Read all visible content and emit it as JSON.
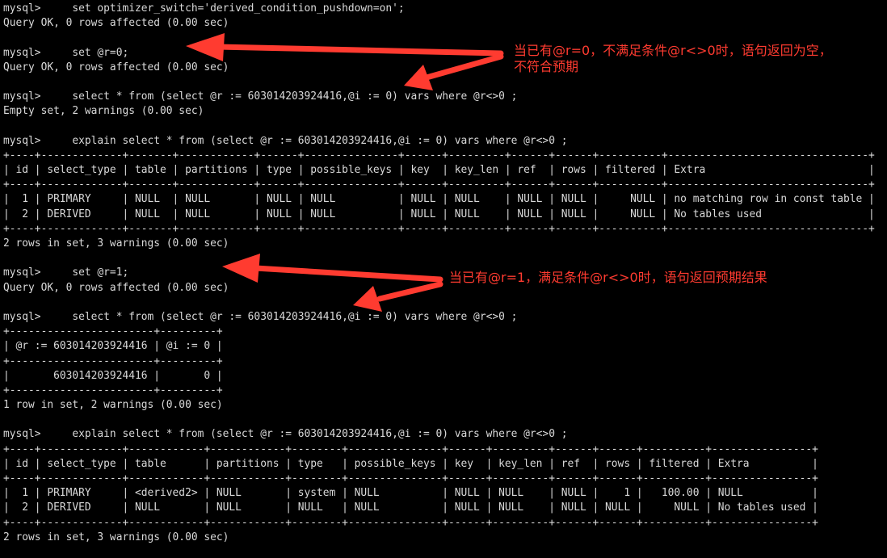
{
  "terminal": {
    "lines": [
      "mysql>     set optimizer_switch='derived_condition_pushdown=on';",
      "Query OK, 0 rows affected (0.00 sec)",
      "",
      "mysql>     set @r=0;",
      "Query OK, 0 rows affected (0.00 sec)",
      "",
      "mysql>     select * from (select @r := 603014203924416,@i := 0) vars where @r<>0 ;",
      "Empty set, 2 warnings (0.00 sec)",
      "",
      "mysql>     explain select * from (select @r := 603014203924416,@i := 0) vars where @r<>0 ;",
      "+----+-------------+-------+------------+------+---------------+------+---------+------+------+----------+--------------------------------+",
      "| id | select_type | table | partitions | type | possible_keys | key  | key_len | ref  | rows | filtered | Extra                          |",
      "+----+-------------+-------+------------+------+---------------+------+---------+------+------+----------+--------------------------------+",
      "|  1 | PRIMARY     | NULL  | NULL       | NULL | NULL          | NULL | NULL    | NULL | NULL |     NULL | no matching row in const table |",
      "|  2 | DERIVED     | NULL  | NULL       | NULL | NULL          | NULL | NULL    | NULL | NULL |     NULL | No tables used                 |",
      "+----+-------------+-------+------------+------+---------------+------+---------+------+------+----------+--------------------------------+",
      "2 rows in set, 3 warnings (0.00 sec)",
      "",
      "mysql>     set @r=1;",
      "Query OK, 0 rows affected (0.00 sec)",
      "",
      "mysql>     select * from (select @r := 603014203924416,@i := 0) vars where @r<>0 ;",
      "+-----------------------+---------+",
      "| @r := 603014203924416 | @i := 0 |",
      "+-----------------------+---------+",
      "|       603014203924416 |       0 |",
      "+-----------------------+---------+",
      "1 row in set, 2 warnings (0.00 sec)",
      "",
      "mysql>     explain select * from (select @r := 603014203924416,@i := 0) vars where @r<>0 ;",
      "+----+-------------+------------+------------+--------+---------------+------+---------+------+------+----------+----------------+",
      "| id | select_type | table      | partitions | type   | possible_keys | key  | key_len | ref  | rows | filtered | Extra          |",
      "+----+-------------+------------+------------+--------+---------------+------+---------+------+------+----------+----------------+",
      "|  1 | PRIMARY     | <derived2> | NULL       | system | NULL          | NULL | NULL    | NULL |    1 |   100.00 | NULL           |",
      "|  2 | DERIVED     | NULL       | NULL       | NULL   | NULL          | NULL | NULL    | NULL | NULL |     NULL | No tables used |",
      "+----+-------------+------------+------------+--------+---------------+------+---------+------+------+----------+----------------+",
      "2 rows in set, 3 warnings (0.00 sec)"
    ]
  },
  "annotations": {
    "note_1": "当已有@r=0，不满足条件@r<>0时，语句返回为空，\n不符合预期",
    "note_2": "当已有@r=1，满足条件@r<>0时，语句返回预期结果",
    "color": "#ff3b30",
    "arrow_icon": "red-arrow-icon"
  },
  "colors": {
    "background": "#000000",
    "text": "#d9d9d9"
  }
}
